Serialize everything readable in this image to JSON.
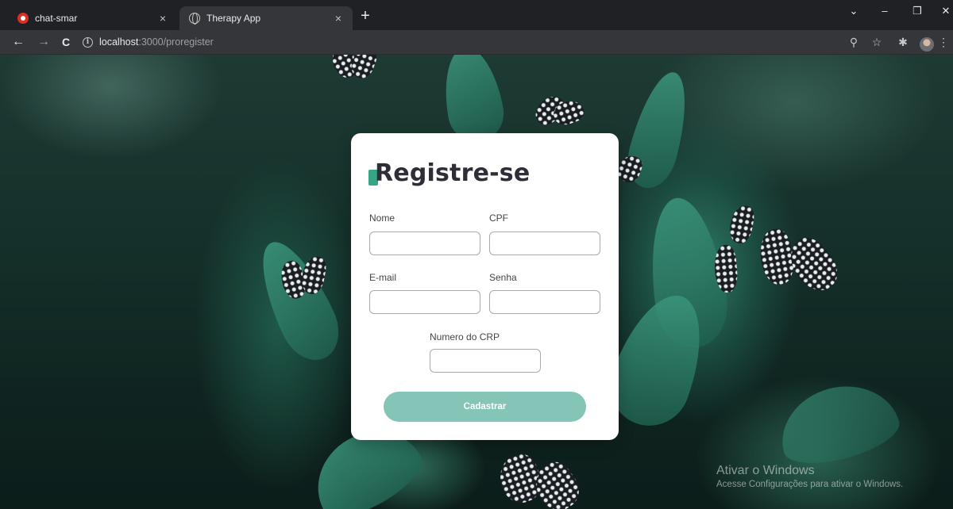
{
  "browser": {
    "tabs": [
      {
        "title": "chat-smar",
        "close": "×"
      },
      {
        "title": "Therapy App",
        "close": "×"
      }
    ],
    "new_tab": "+",
    "window_controls": {
      "dropdown": "⌄",
      "minimize": "–",
      "restore": "❐",
      "close": "✕"
    },
    "nav": {
      "back": "←",
      "forward": "→",
      "reload": "C"
    },
    "url": {
      "host": "localhost",
      "path": ":3000/proregister"
    },
    "toolbar_icons": {
      "zoom": "⚲",
      "star": "☆",
      "extensions": "✱",
      "menu": "⋮"
    }
  },
  "card": {
    "title": "Registre-se",
    "fields": {
      "nome": {
        "label": "Nome",
        "value": "",
        "placeholder": ""
      },
      "cpf": {
        "label": "CPF",
        "value": "",
        "placeholder": ""
      },
      "email": {
        "label": "E-mail",
        "value": "",
        "placeholder": ""
      },
      "senha": {
        "label": "Senha",
        "value": "",
        "placeholder": ""
      },
      "crp": {
        "label": "Numero do CRP",
        "value": "",
        "placeholder": ""
      }
    },
    "submit_label": "Cadastrar"
  },
  "watermark": {
    "title": "Ativar o Windows",
    "subtitle": "Acesse Configurações para ativar o Windows."
  },
  "colors": {
    "accent": "#35a586",
    "button": "#84c5b8",
    "title": "#2e2e38",
    "browser_bg": "#202124",
    "toolbar_bg": "#35363a"
  },
  "icons": [
    "app-favicon-icon",
    "globe-icon",
    "close-icon",
    "plus-icon",
    "back-arrow-icon",
    "forward-arrow-icon",
    "reload-icon",
    "info-icon",
    "zoom-icon",
    "star-icon",
    "puzzle-icon",
    "menu-dots-icon"
  ]
}
